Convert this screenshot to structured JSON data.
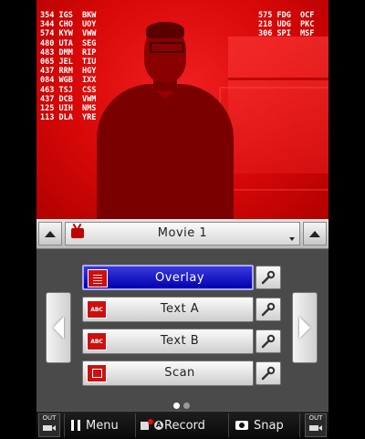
{
  "camera_view": {
    "codes_left": [
      "354 IGS  BKW",
      "344 CHO  UOY",
      "574 KYW  VWW",
      "480 UTA  SEG",
      "483 DMM  RIP",
      "065 JEL  TIU",
      "437 RRM  HGY",
      "084 WGB  IXX",
      "463 TSJ  CSS",
      "437 DCB  VWM",
      "125 UIH  NMS",
      "113 DLA  YRE"
    ],
    "codes_right": [
      "575 FDG  OCF",
      "218 UDG  PKC",
      "306 SPI  MSF"
    ]
  },
  "header": {
    "title": "Movie 1"
  },
  "modes": [
    {
      "label": "Overlay",
      "icon": "overlay-grid-icon",
      "selected": true
    },
    {
      "label": "Text A",
      "icon": "abc-text-icon",
      "selected": false
    },
    {
      "label": "Text B",
      "icon": "abc-text-icon",
      "selected": false
    },
    {
      "label": "Scan",
      "icon": "scan-frame-icon",
      "selected": false
    }
  ],
  "page_indicator": {
    "current": 1,
    "total": 2
  },
  "bottom_bar": {
    "out_left": "OUT",
    "menu_label": "Menu",
    "record_badge": "A",
    "record_label": "Record",
    "snap_label": "Snap",
    "out_right": "OUT"
  },
  "colors": {
    "camera_tint": "#d80808",
    "selected_button": "#0000b0",
    "icon_red": "#cc1010"
  }
}
